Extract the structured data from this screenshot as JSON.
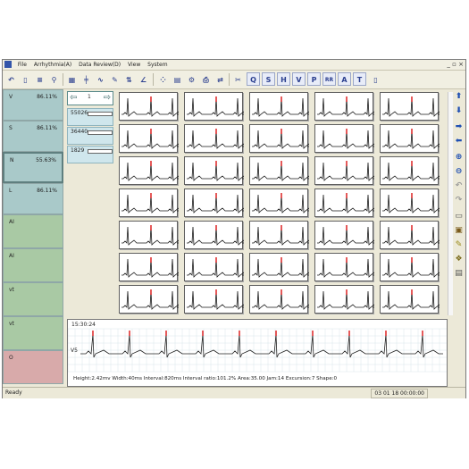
{
  "menu": {
    "items": [
      "File",
      "Arrhythmia(A)",
      "Data Review(D)",
      "View",
      "System"
    ]
  },
  "toolbar": {
    "letter_buttons": [
      "Q",
      "S",
      "H",
      "V",
      "P",
      "RR",
      "A",
      "T"
    ]
  },
  "leads": [
    {
      "name": "V",
      "percent": "86.11%",
      "bg": "#a9c9c9"
    },
    {
      "name": "S",
      "percent": "86.11%",
      "bg": "#a9c9c9"
    },
    {
      "name": "N",
      "percent": "55.63%",
      "bg": "#a9c9c9"
    },
    {
      "name": "L",
      "percent": "86.11%",
      "bg": "#a9c9c9"
    },
    {
      "name": "AI",
      "percent": "",
      "bg": "#a9c9a4"
    },
    {
      "name": "AI",
      "percent": "",
      "bg": "#a9c9a4"
    },
    {
      "name": "vt",
      "percent": "",
      "bg": "#a9c9a4"
    },
    {
      "name": "vt",
      "percent": "",
      "bg": "#a9c9a4"
    },
    {
      "name": "O",
      "percent": "",
      "bg": "#d8aaaa"
    }
  ],
  "nav": {
    "page": "1"
  },
  "templates": [
    {
      "id": "55026"
    },
    {
      "id": "36440"
    },
    {
      "id": "1829"
    }
  ],
  "grid": {
    "rows": 7,
    "cols": 5
  },
  "strip": {
    "time": "15:30:24",
    "lead_label": "V5",
    "measurement": "Height:2.42mv  Width:40ms  Interval:820ms  Interval ratio:101.2%  Area:35.00  Jam:14  Excursion:7  Shape:0"
  },
  "status": {
    "ready": "Ready",
    "time": "03 01 18 00:00:00"
  }
}
